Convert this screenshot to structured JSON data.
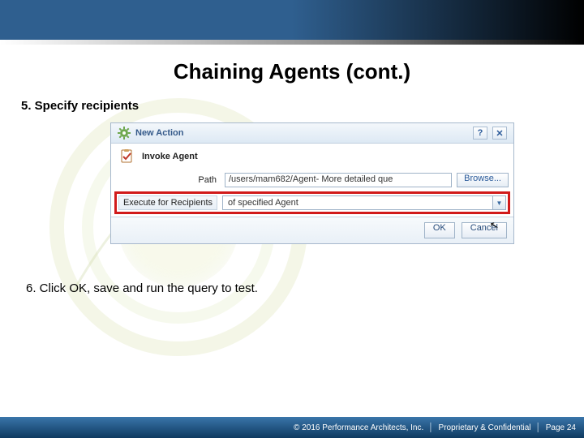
{
  "slide": {
    "title": "Chaining Agents (cont.)",
    "step5": "5. Specify recipients",
    "step6": "6. Click OK, save and run the query to test."
  },
  "dialog": {
    "title": "New Action",
    "help_glyph": "?",
    "close_glyph": "✕",
    "invoke_label": "Invoke Agent",
    "path_label": "Path",
    "path_value": "/users/mam682/Agent- More detailed que",
    "browse_label": "Browse...",
    "recipients_label": "Execute for Recipients",
    "recipients_value": "of specified Agent",
    "ok_label": "OK",
    "cancel_label": "Cancel"
  },
  "footer": {
    "copyright": "© 2016 Performance Architects, Inc.",
    "proprietary": "Proprietary & Confidential",
    "page": "Page 24"
  }
}
